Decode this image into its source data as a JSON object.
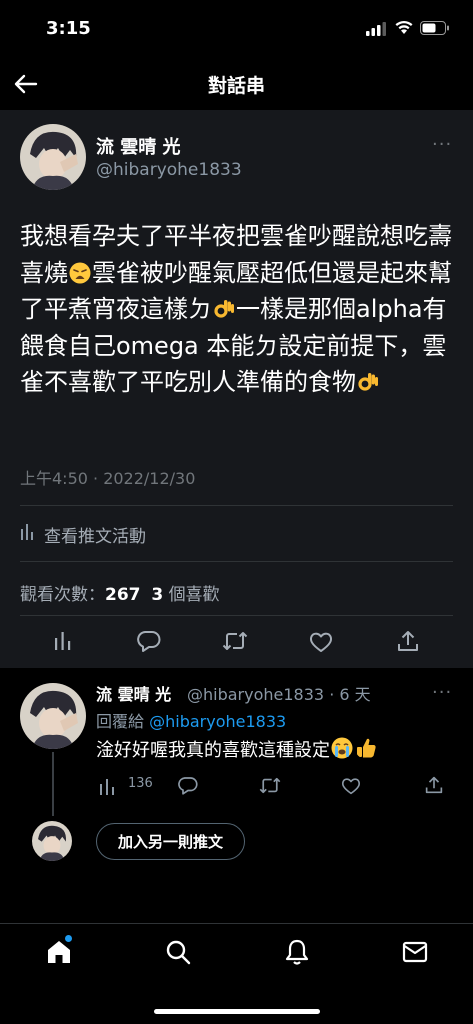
{
  "status_bar": {
    "time": "3:15"
  },
  "header": {
    "title": "對話串"
  },
  "main_tweet": {
    "author_name": "流 雲晴 光",
    "author_handle": "@hibaryohe1833",
    "more": "···",
    "body_parts": [
      "我想看孕夫了平半夜把雲雀吵醒說想吃壽喜燒",
      "雲雀被吵醒氣壓超低但還是起來幫了平煮宵夜這樣ㄉ",
      "一樣是那個alpha有餵食自己omega 本能ㄉ設定前提下，雲雀不喜歡了平吃別人準備的食物"
    ],
    "timestamp": "上午4:50 · 2022/12/30",
    "activity_label": "查看推文活動",
    "views_label": "觀看次數：",
    "views_count": "267",
    "likes_count": "3",
    "likes_label": "個喜歡"
  },
  "reply_tweet": {
    "author_name": "流 雲晴 光",
    "author_handle": "@hibaryohe1833",
    "time_ago": "· 6 天",
    "more": "···",
    "reply_to_label": "回覆給",
    "reply_to_handle": "@hibaryohe1833",
    "body": "淦好好喔我真的喜歡這種設定",
    "views_count": "136"
  },
  "add_button_label": "加入另一則推文",
  "icons": {
    "back": "arrow-left-icon",
    "analytics": "bar-chart-icon",
    "reply": "speech-bubble-icon",
    "retweet": "retweet-icon",
    "like": "heart-icon",
    "share": "share-icon",
    "home": "home-icon",
    "search": "search-icon",
    "notifications": "bell-icon",
    "messages": "envelope-icon"
  },
  "colors": {
    "accent": "#1d9bf0",
    "muted": "#71767b",
    "background": "#000000",
    "card": "#16181c"
  }
}
